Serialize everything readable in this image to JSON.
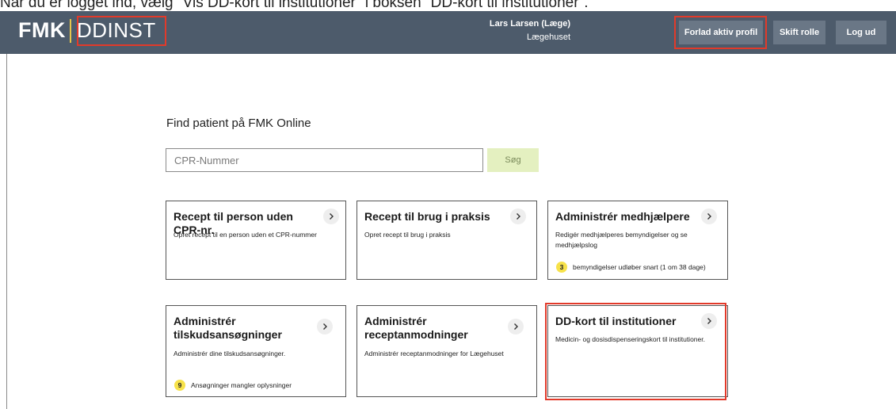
{
  "caption": "Når du er logget ind, vælg \"Vis DD-kort til institutioner\" i boksen \"DD-kort til institutioner\".",
  "header": {
    "logo_fmk": "FMK",
    "logo_app": "DDINST",
    "user_name": "Lars Larsen (Læge)",
    "user_org": "Lægehuset",
    "buttons": {
      "leave_profile": "Forlad aktiv profil",
      "switch_role": "Skift rolle",
      "logout": "Log ud"
    }
  },
  "search": {
    "title": "Find patient på FMK Online",
    "placeholder": "CPR-Nummer",
    "value": "",
    "button": "Søg"
  },
  "cards": [
    {
      "title": "Recept til person uden CPR-nr.",
      "description": "Opret recept til en person uden et CPR-nummer"
    },
    {
      "title": "Recept til brug i praksis",
      "description": "Opret recept til brug i praksis"
    },
    {
      "title": "Administrér medhjælpere",
      "description": "Redigér medhjælperes bemyndigelser og se medhjælpslog",
      "badge_count": "3",
      "badge_text": "bemyndigelser udløber snart (1 om 38 dage)"
    },
    {
      "title": "Administrér tilskudsansøgninger",
      "description": "Administrér dine tilskudsansøgninger.",
      "badge_count": "9",
      "badge_text": "Ansøgninger mangler oplysninger"
    },
    {
      "title": "Administrér receptanmodninger",
      "description": "Administrér receptanmodninger for Lægehuset"
    },
    {
      "title": "DD-kort til institutioner",
      "description": "Medicin- og dosisdispenseringskort til institutioner."
    }
  ],
  "icons": {
    "card_chevron": "chevron-right-icon"
  },
  "colors": {
    "header_bg": "#4d5b6b",
    "header_button_bg": "#6a7786",
    "logo_separator": "#e6c64a",
    "highlight": "#e23a2a",
    "search_button_bg": "#e4f0c0",
    "badge_bg": "#f7e24a"
  }
}
